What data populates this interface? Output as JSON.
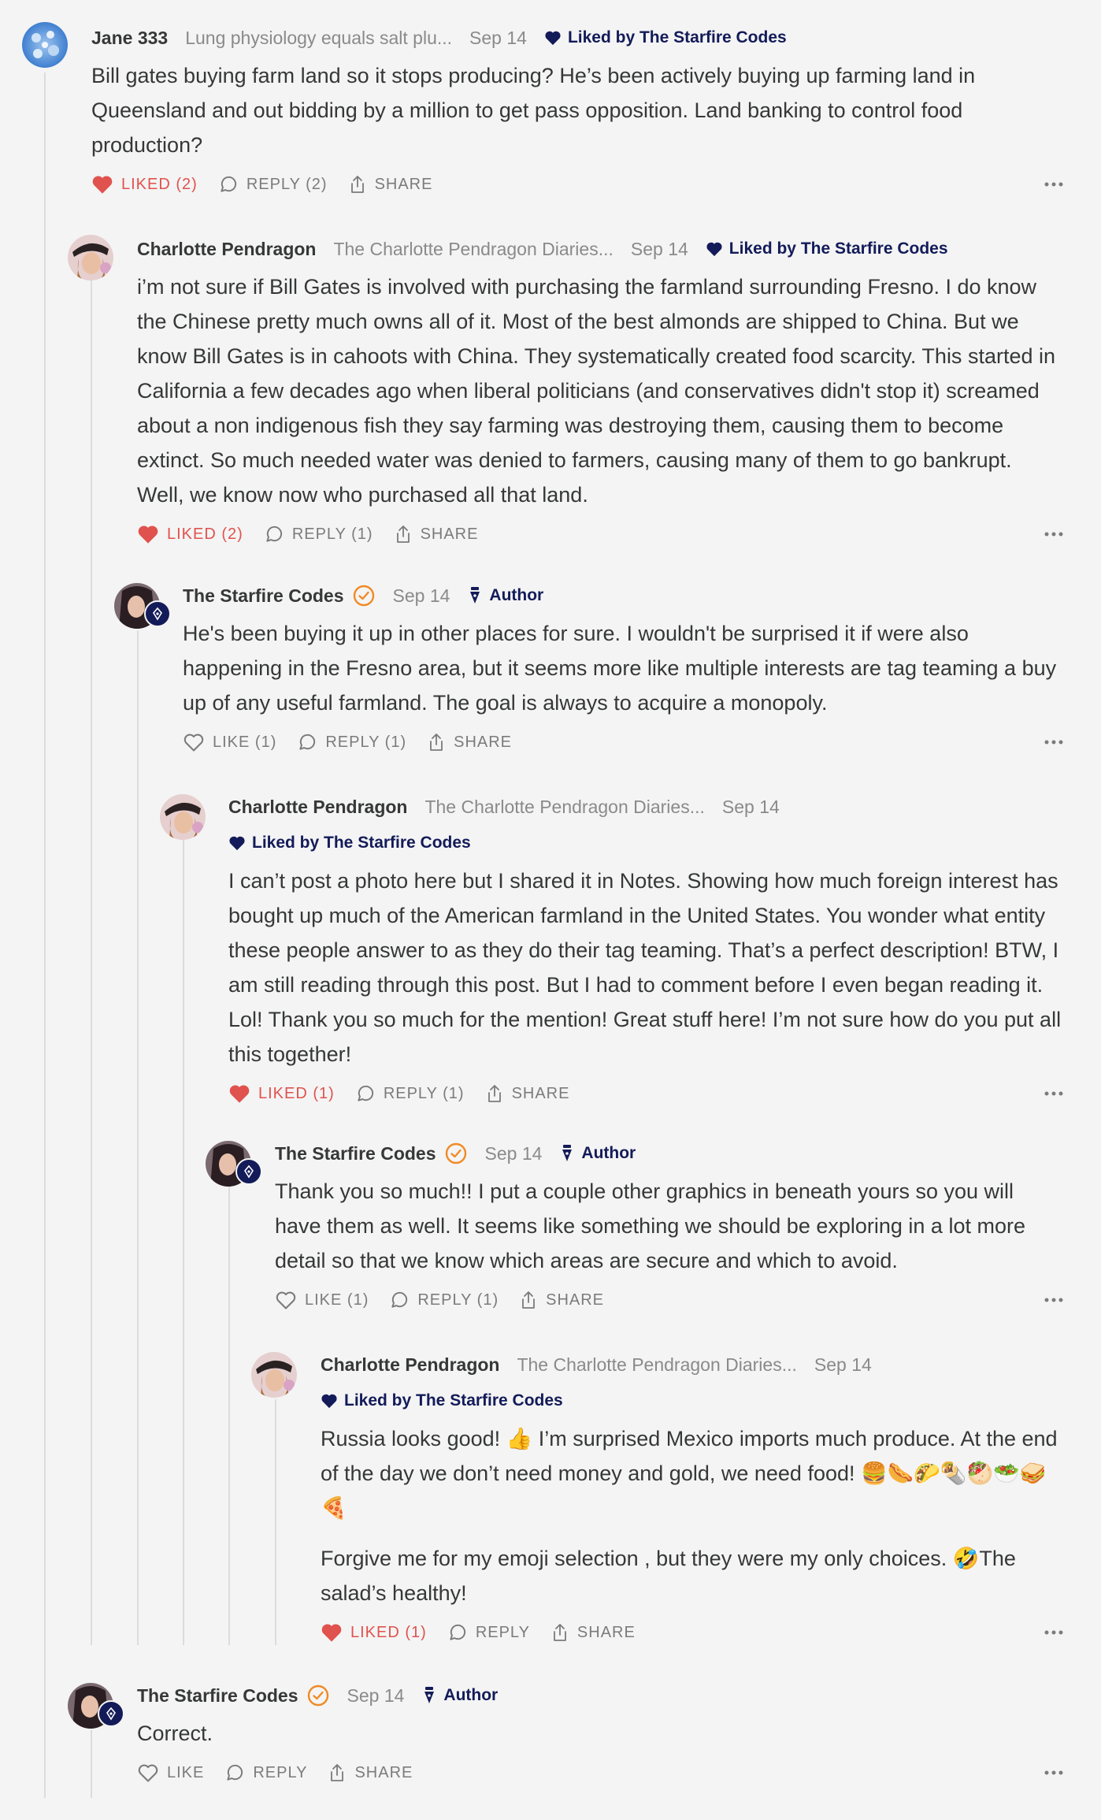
{
  "labels": {
    "liked_by_prefix": "Liked by",
    "author": "Author",
    "share": "SHARE"
  },
  "colors": {
    "accent_like": "#e0524e",
    "navy": "#131b59",
    "verified": "#f08a24",
    "muted": "#8a8a8a"
  },
  "comments": [
    {
      "author": "Jane 333",
      "publication": "Lung physiology equals salt plu...",
      "date": "Sep 14",
      "liked_by": "Liked by The Starfire Codes",
      "body": [
        "Bill gates buying farm land so it stops producing? He’s been actively buying up farming land in Queensland and out bidding by a million to get pass opposition. Land banking to control food production?"
      ],
      "like_label": "LIKED (2)",
      "reply_label": "REPLY (2)",
      "share_label": "SHARE"
    },
    {
      "author": "Charlotte Pendragon",
      "publication": "The Charlotte Pendragon Diaries...",
      "date": "Sep 14",
      "liked_by": "Liked by The Starfire Codes",
      "body": [
        "i’m not sure if Bill Gates is involved with purchasing the farmland surrounding Fresno. I do know the Chinese pretty much owns all of it. Most of the best almonds are shipped to China. But we know Bill Gates is in cahoots with China. They systematically created food scarcity. This started in California a few decades ago when liberal politicians (and conservatives didn't stop it) screamed about a non indigenous fish they say farming was destroying them, causing them to become extinct. So much needed water was denied to farmers, causing many of them to go bankrupt. Well, we know now who purchased all that land."
      ],
      "like_label": "LIKED (2)",
      "reply_label": "REPLY (1)",
      "share_label": "SHARE"
    },
    {
      "author": "The Starfire Codes",
      "date": "Sep 14",
      "author_tag": "Author",
      "body": [
        "He's been buying it up in other places for sure. I wouldn't be surprised it if were also happening in the Fresno area, but it seems more like multiple interests are tag teaming a buy up of any useful farmland. The goal is always to acquire a monopoly."
      ],
      "like_label": "LIKE (1)",
      "reply_label": "REPLY (1)",
      "share_label": "SHARE"
    },
    {
      "author": "Charlotte Pendragon",
      "publication": "The Charlotte Pendragon Diaries...",
      "date": "Sep 14",
      "liked_by": "Liked by The Starfire Codes",
      "body": [
        "I can’t post a photo here but I shared it in Notes. Showing how much foreign interest has bought up much of the American farmland in the United States. You wonder what entity these people answer to as they do their tag teaming. That’s a perfect description! BTW, I am still reading through this post. But I had to comment before I even began reading it. Lol! Thank you so much for the mention! Great stuff here! I’m not sure how do you put all this together!"
      ],
      "like_label": "LIKED (1)",
      "reply_label": "REPLY (1)",
      "share_label": "SHARE"
    },
    {
      "author": "The Starfire Codes",
      "date": "Sep 14",
      "author_tag": "Author",
      "body": [
        "Thank you so much!! I put a couple other graphics in beneath yours so you will have them as well. It seems like something we should be exploring in a lot more detail so that we know which areas are secure and which to avoid."
      ],
      "like_label": "LIKE (1)",
      "reply_label": "REPLY (1)",
      "share_label": "SHARE"
    },
    {
      "author": "Charlotte Pendragon",
      "publication": "The Charlotte Pendragon Diaries...",
      "date": "Sep 14",
      "liked_by": "Liked by The Starfire Codes",
      "body": [
        "Russia looks good! 👍 I’m surprised Mexico imports much produce. At the end of the day we don’t need money and gold, we need food! 🍔🌭🌮🌯🥙🥗🥪🍕",
        "Forgive me for my emoji selection , but they were my only choices. 🤣The salad’s healthy!"
      ],
      "like_label": "LIKED (1)",
      "reply_label": "REPLY",
      "share_label": "SHARE"
    },
    {
      "author": "The Starfire Codes",
      "date": "Sep 14",
      "author_tag": "Author",
      "body": [
        "Correct."
      ],
      "like_label": "LIKE",
      "reply_label": "REPLY",
      "share_label": "SHARE"
    }
  ]
}
